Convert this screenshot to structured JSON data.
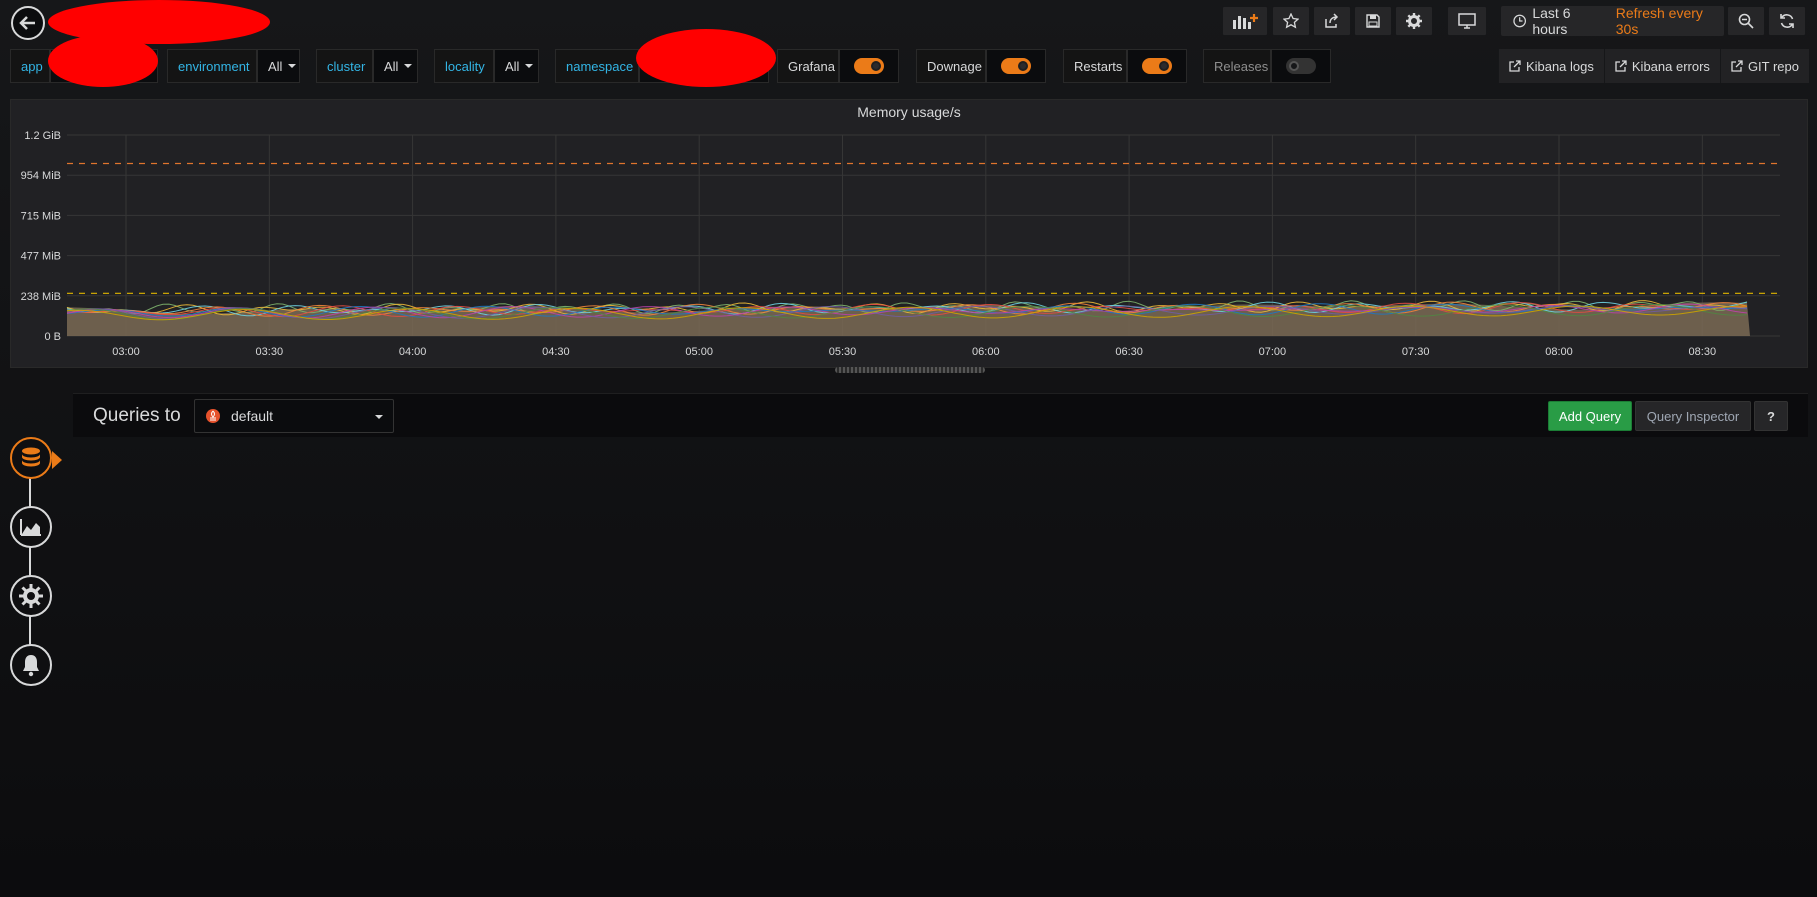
{
  "topbar": {
    "buttons": [
      "add-panel",
      "star",
      "share",
      "save",
      "settings",
      "tv-mode"
    ],
    "time_range": "Last 6 hours",
    "refresh": "Refresh every 30s"
  },
  "variables": [
    {
      "label": "app",
      "value": ""
    },
    {
      "label": "environment",
      "value": "All"
    },
    {
      "label": "cluster",
      "value": "All"
    },
    {
      "label": "locality",
      "value": "All"
    },
    {
      "label": "namespace",
      "value": ""
    }
  ],
  "toggles": [
    {
      "label": "Grafana",
      "on": true
    },
    {
      "label": "Downage",
      "on": true
    },
    {
      "label": "Restarts",
      "on": true
    },
    {
      "label": "Releases",
      "on": false
    }
  ],
  "links": [
    "Kibana logs",
    "Kibana errors",
    "GIT repo"
  ],
  "colors": {
    "accent": "#eb7b18",
    "link": "#33b5e5",
    "green": "#299c46"
  },
  "chart_data": {
    "type": "line",
    "title": "Memory usage/s",
    "yticks": [
      "0 B",
      "238 MiB",
      "477 MiB",
      "715 MiB",
      "954 MiB",
      "1.2 GiB"
    ],
    "ylim": [
      0,
      1.2
    ],
    "xticks": [
      "03:00",
      "03:30",
      "04:00",
      "04:30",
      "05:00",
      "05:30",
      "06:00",
      "06:30",
      "07:00",
      "07:30",
      "08:00",
      "08:30"
    ],
    "thresholds": [
      1.03,
      0.255
    ],
    "series_colors": [
      "#7eb26d",
      "#eab839",
      "#6ed0e0",
      "#ef843c",
      "#e24d42",
      "#1f78c1",
      "#ba43a9",
      "#705da0",
      "#508642",
      "#cca300"
    ],
    "area_top": 0.15
  },
  "query": {
    "title": "Queries to",
    "datasource": "default",
    "add_query": "Add Query",
    "inspector": "Query Inspector",
    "help": "?"
  }
}
